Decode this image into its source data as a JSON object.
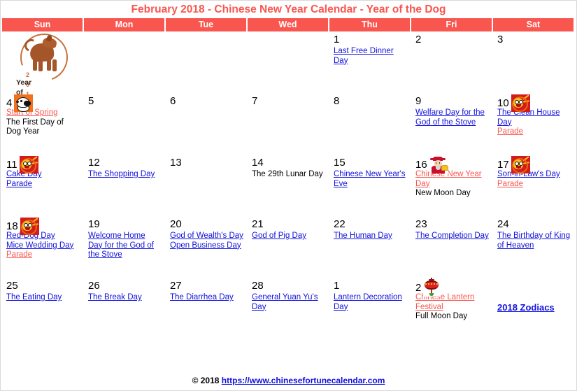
{
  "title": "February 2018 - Chinese New Year Calendar - Year of the Dog",
  "colors": {
    "accent_red": "#f9564f",
    "link_blue": "#1111dd",
    "header_text": "#ffffff",
    "body_text": "#000000"
  },
  "weekdays": [
    "Sun",
    "Mon",
    "Tue",
    "Wed",
    "Thu",
    "Fri",
    "Sat"
  ],
  "emblem": {
    "year": "2 0 1 8",
    "caption": "Year of Dog"
  },
  "zodiac_link": "2018 Zodiacs",
  "footer": {
    "copyright": "© 2018",
    "url": "https://www.chinesefortunecalendar.com"
  },
  "weeks": [
    {
      "days": [
        {
          "num": "",
          "icon": "year-of-dog-emblem",
          "events": []
        },
        {
          "num": "",
          "icon": "",
          "events": []
        },
        {
          "num": "",
          "icon": "",
          "events": []
        },
        {
          "num": "",
          "icon": "",
          "events": []
        },
        {
          "num": "1",
          "icon": "",
          "events": [
            {
              "text": "Last Free Dinner Day",
              "style": "link-blue"
            }
          ]
        },
        {
          "num": "2",
          "icon": "",
          "events": []
        },
        {
          "num": "3",
          "icon": "",
          "events": []
        }
      ]
    },
    {
      "days": [
        {
          "num": "4",
          "icon": "dog-face-icon",
          "events": [
            {
              "text": "Start of Spring",
              "style": "link-red"
            },
            {
              "text": "The First Day of Dog Year",
              "style": "plain"
            }
          ]
        },
        {
          "num": "5",
          "icon": "",
          "events": []
        },
        {
          "num": "6",
          "icon": "",
          "events": []
        },
        {
          "num": "7",
          "icon": "",
          "events": []
        },
        {
          "num": "8",
          "icon": "",
          "events": []
        },
        {
          "num": "9",
          "icon": "",
          "events": [
            {
              "text": "Welfare Day for the God of the Stove",
              "style": "link-blue"
            }
          ]
        },
        {
          "num": "10",
          "icon": "lion-dance-icon",
          "events": [
            {
              "text": "The Clean House Day",
              "style": "link-blue"
            },
            {
              "text": "Parade",
              "style": "link-red"
            }
          ]
        }
      ]
    },
    {
      "days": [
        {
          "num": "11",
          "icon": "lion-dance-icon",
          "events": [
            {
              "text": "Cake Day",
              "style": "link-blue"
            },
            {
              "text": "Parade",
              "style": "link-blue"
            }
          ]
        },
        {
          "num": "12",
          "icon": "",
          "events": [
            {
              "text": "The Shopping Day",
              "style": "link-blue"
            }
          ]
        },
        {
          "num": "13",
          "icon": "",
          "events": []
        },
        {
          "num": "14",
          "icon": "",
          "events": [
            {
              "text": "The 29th Lunar Day",
              "style": "plain"
            }
          ]
        },
        {
          "num": "15",
          "icon": "",
          "events": [
            {
              "text": "Chinese New Year's Eve",
              "style": "link-blue"
            }
          ]
        },
        {
          "num": "16",
          "icon": "god-of-wealth-icon",
          "events": [
            {
              "text": "Chinese New Year Day",
              "style": "link-red"
            },
            {
              "text": "New Moon Day",
              "style": "plain"
            }
          ]
        },
        {
          "num": "17",
          "icon": "lion-dance-icon",
          "events": [
            {
              "text": "Son-in-Law's Day",
              "style": "link-blue"
            },
            {
              "text": "Parade",
              "style": "link-red"
            }
          ]
        }
      ]
    },
    {
      "days": [
        {
          "num": "18",
          "icon": "lion-dance-icon",
          "events": [
            {
              "text": "Red-Dog Day",
              "style": "link-blue"
            },
            {
              "text": "Mice Wedding Day",
              "style": "link-blue"
            },
            {
              "text": "Parade",
              "style": "link-red"
            }
          ]
        },
        {
          "num": "19",
          "icon": "",
          "events": [
            {
              "text": "Welcome Home Day for the God of the Stove",
              "style": "link-blue"
            }
          ]
        },
        {
          "num": "20",
          "icon": "",
          "events": [
            {
              "text": "God of Wealth's Day",
              "style": "link-blue"
            },
            {
              "text": "Open Business Day",
              "style": "link-blue"
            }
          ]
        },
        {
          "num": "21",
          "icon": "",
          "events": [
            {
              "text": "God of Pig Day",
              "style": "link-blue"
            }
          ]
        },
        {
          "num": "22",
          "icon": "",
          "events": [
            {
              "text": "The Human Day",
              "style": "link-blue"
            }
          ]
        },
        {
          "num": "23",
          "icon": "",
          "events": [
            {
              "text": "The Completion Day",
              "style": "link-blue"
            }
          ]
        },
        {
          "num": "24",
          "icon": "",
          "events": [
            {
              "text": "The Birthday of King of Heaven",
              "style": "link-blue"
            }
          ]
        }
      ]
    },
    {
      "days": [
        {
          "num": "25",
          "icon": "",
          "events": [
            {
              "text": "The Eating Day",
              "style": "link-blue"
            }
          ]
        },
        {
          "num": "26",
          "icon": "",
          "events": [
            {
              "text": "The Break Day",
              "style": "link-blue"
            }
          ]
        },
        {
          "num": "27",
          "icon": "",
          "events": [
            {
              "text": "The Diarrhea Day",
              "style": "link-blue"
            }
          ]
        },
        {
          "num": "28",
          "icon": "",
          "events": [
            {
              "text": "General Yuan Yu's Day",
              "style": "link-blue"
            }
          ]
        },
        {
          "num": "1",
          "icon": "",
          "events": [
            {
              "text": "Lantern Decoration Day",
              "style": "link-blue"
            }
          ]
        },
        {
          "num": "2",
          "icon": "lantern-icon",
          "events": [
            {
              "text": "Chinese Lantern Festival",
              "style": "link-red"
            },
            {
              "text": "Full Moon Day",
              "style": "plain"
            }
          ]
        },
        {
          "num": "",
          "icon": "",
          "events": [],
          "zodiac": true
        }
      ]
    }
  ]
}
